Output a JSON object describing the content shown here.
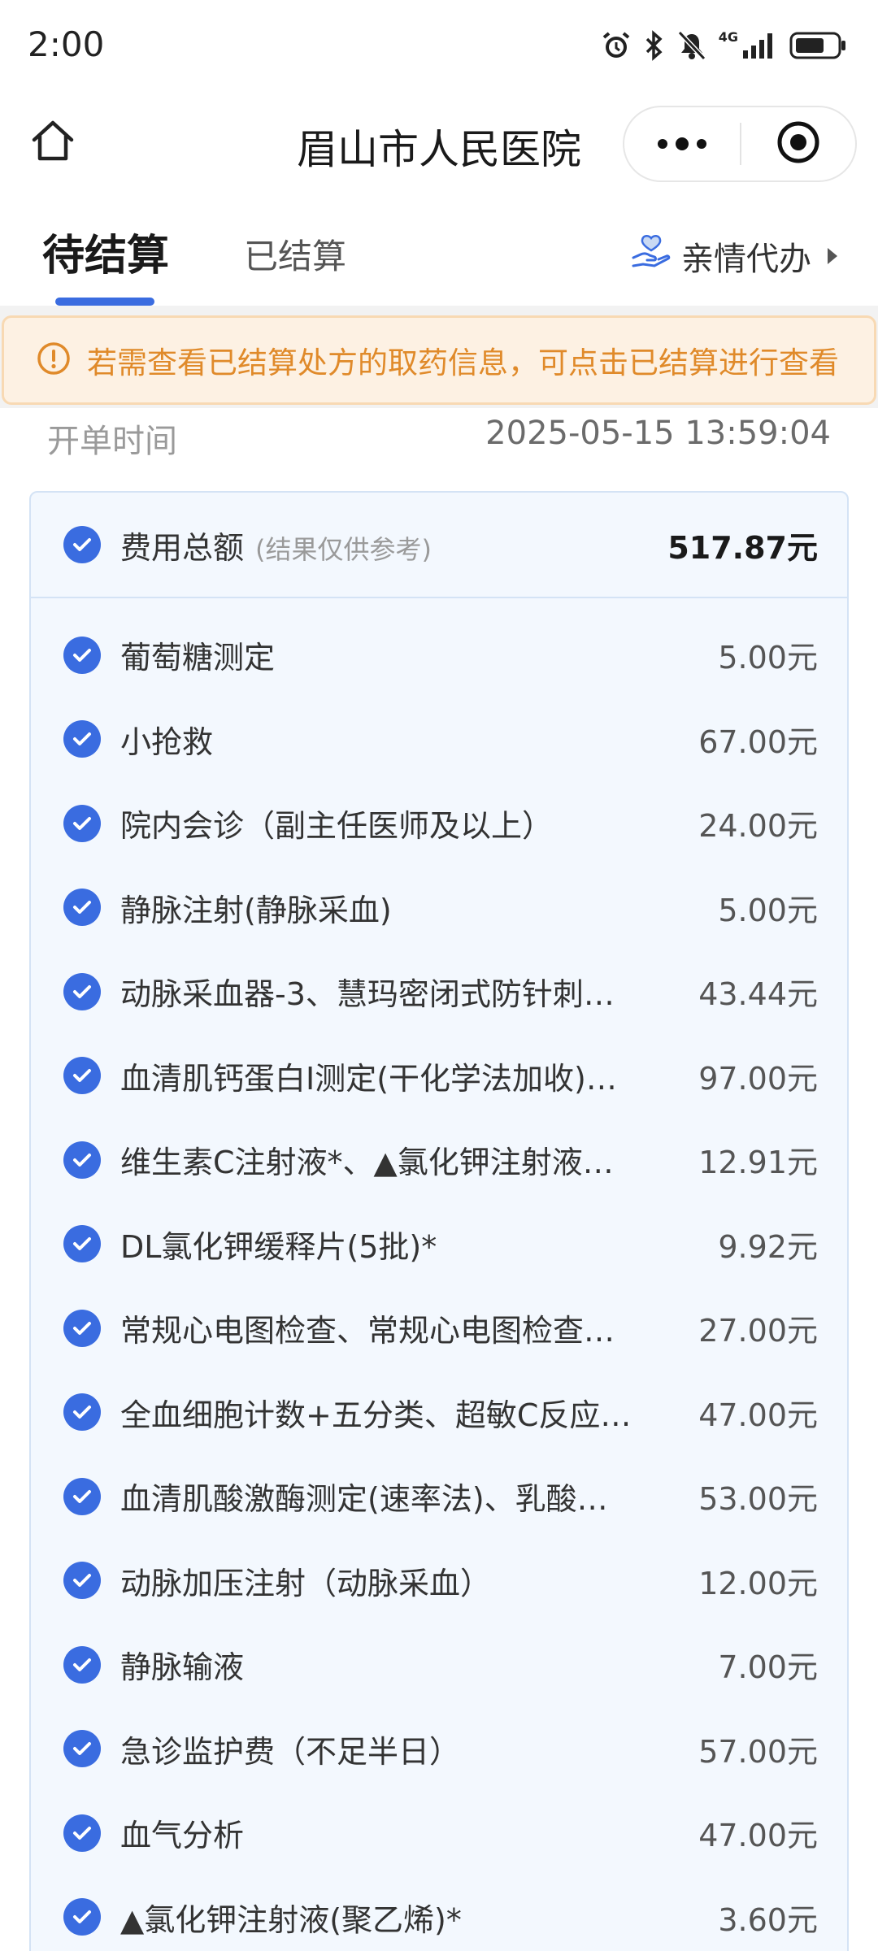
{
  "status_bar": {
    "time": "2:00",
    "icons": [
      "alarm-icon",
      "bluetooth-icon",
      "mute-icon",
      "signal-icon",
      "battery-icon"
    ],
    "network_label": "4G"
  },
  "title_bar": {
    "title": "眉山市人民医院"
  },
  "tabs": {
    "active": "待结算",
    "inactive": "已结算",
    "proxy_label": "亲情代办"
  },
  "notice": {
    "text": "若需查看已结算处方的取药信息，可点击已结算进行查看"
  },
  "order": {
    "time_label": "开单时间",
    "time_value": "2025-05-15 13:59:04"
  },
  "summary": {
    "label": "费用总额",
    "note": "(结果仅供参考)",
    "amount": "517.87元"
  },
  "items": [
    {
      "name": "葡萄糖测定",
      "price": "5.00元"
    },
    {
      "name": "小抢救",
      "price": "67.00元"
    },
    {
      "name": "院内会诊（副主任医师及以上）",
      "price": "24.00元"
    },
    {
      "name": "静脉注射(静脉采血)",
      "price": "5.00元"
    },
    {
      "name": "动脉采血器-3、慧玛密闭式防针刺…",
      "price": "43.44元"
    },
    {
      "name": "血清肌钙蛋白I测定(干化学法加收)…",
      "price": "97.00元"
    },
    {
      "name": "维生素C注射液*、▲氯化钾注射液…",
      "price": "12.91元"
    },
    {
      "name": "DL氯化钾缓释片(5批)*",
      "price": "9.92元"
    },
    {
      "name": "常规心电图检查、常规心电图检查…",
      "price": "27.00元"
    },
    {
      "name": "全血细胞计数+五分类、超敏C反应…",
      "price": "47.00元"
    },
    {
      "name": "血清肌酸激酶测定(速率法)、乳酸…",
      "price": "53.00元"
    },
    {
      "name": "动脉加压注射（动脉采血）",
      "price": "12.00元"
    },
    {
      "name": "静脉输液",
      "price": "7.00元"
    },
    {
      "name": "急诊监护费（不足半日）",
      "price": "57.00元"
    },
    {
      "name": "血气分析",
      "price": "47.00元"
    },
    {
      "name": "▲氯化钾注射液(聚乙烯)*",
      "price": "3.60元"
    }
  ],
  "colors": {
    "accent": "#3a6ce0",
    "notice_text": "#e08a2a",
    "notice_bg": "#fdf1e3",
    "card_bg": "#f3f8fe"
  }
}
